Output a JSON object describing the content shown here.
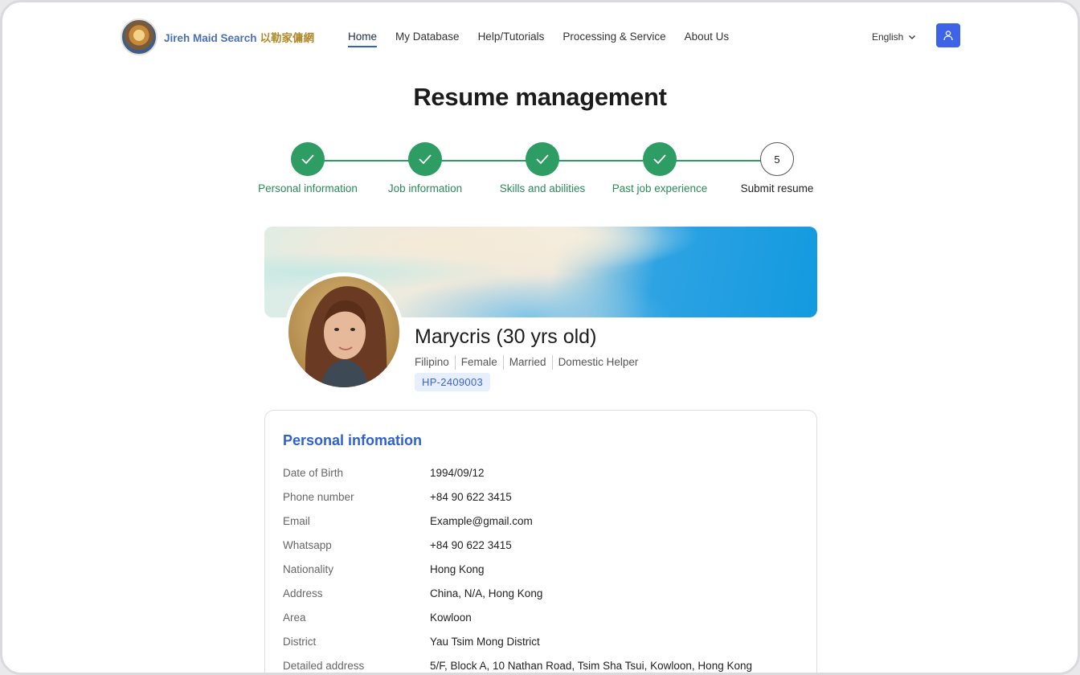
{
  "header": {
    "logo_text_en": "Jireh Maid Search",
    "logo_text_zh": "以勒家傭網",
    "nav": [
      {
        "label": "Home",
        "active": true
      },
      {
        "label": "My Database",
        "active": false
      },
      {
        "label": "Help/Tutorials",
        "active": false
      },
      {
        "label": "Processing & Service",
        "active": false
      },
      {
        "label": "About Us",
        "active": false
      }
    ],
    "language": "English"
  },
  "page_title": "Resume management",
  "steps": [
    {
      "label": "Personal information",
      "status": "done"
    },
    {
      "label": "Job information",
      "status": "done"
    },
    {
      "label": "Skills and abilities",
      "status": "done"
    },
    {
      "label": "Past job experience",
      "status": "done"
    },
    {
      "label": "Submit resume",
      "status": "current",
      "number": "5"
    }
  ],
  "profile": {
    "name": "Marycris (30 yrs old)",
    "tags": [
      "Filipino",
      "Female",
      "Married",
      "Domestic Helper"
    ],
    "code": "HP-2409003"
  },
  "personal_info": {
    "title": "Personal infomation",
    "rows": [
      {
        "label": "Date of Birth",
        "value": "1994/09/12"
      },
      {
        "label": "Phone number",
        "value": "+84 90 622 3415"
      },
      {
        "label": "Email",
        "value": "Example@gmail.com"
      },
      {
        "label": "Whatsapp",
        "value": "+84 90 622 3415"
      },
      {
        "label": "Nationality",
        "value": "Hong Kong"
      },
      {
        "label": "Address",
        "value": "China, N/A, Hong Kong"
      },
      {
        "label": "Area",
        "value": "Kowloon"
      },
      {
        "label": "District",
        "value": "Yau Tsim Mong District"
      },
      {
        "label": "Detailed address",
        "value": "5/F, Block A, 10 Nathan Road, Tsim Sha Tsui, Kowloon, Hong Kong"
      }
    ]
  },
  "colors": {
    "primary": "#2f5fd0",
    "success": "#2d9d64",
    "user_button": "#3d63e8"
  }
}
